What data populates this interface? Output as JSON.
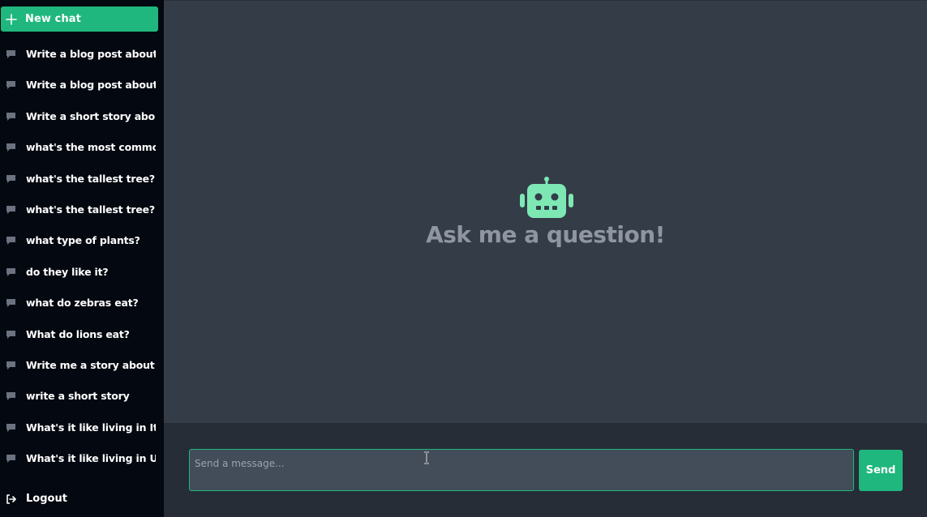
{
  "sidebar": {
    "new_chat_label": "New chat",
    "new_chat_icon": "plus-icon",
    "history": [
      {
        "label": "Write a blog post about li..."
      },
      {
        "label": "Write a blog post about pl..."
      },
      {
        "label": "Write a short story about ..."
      },
      {
        "label": "what's the most common ..."
      },
      {
        "label": "what's the tallest tree?"
      },
      {
        "label": "what's the tallest tree?"
      },
      {
        "label": "what type of plants?"
      },
      {
        "label": "do they like it?"
      },
      {
        "label": "what do zebras eat?"
      },
      {
        "label": "What do lions eat?"
      },
      {
        "label": "Write me a story about a ..."
      },
      {
        "label": "write a short story"
      },
      {
        "label": "What's it like living in Italy?"
      },
      {
        "label": "What's it like living in UK?"
      }
    ],
    "history_icon": "message-icon",
    "logout_label": "Logout",
    "logout_icon": "logout-icon"
  },
  "main": {
    "robot_icon": "robot-icon",
    "headline": "Ask me a question!"
  },
  "composer": {
    "placeholder": "Send a message...",
    "value": "",
    "send_label": "Send"
  },
  "colors": {
    "accent": "#1fb77d",
    "sidebar_bg": "#040810",
    "main_bg": "#343c48",
    "composer_bg": "#262d37",
    "robot": "#7ee8b5"
  }
}
